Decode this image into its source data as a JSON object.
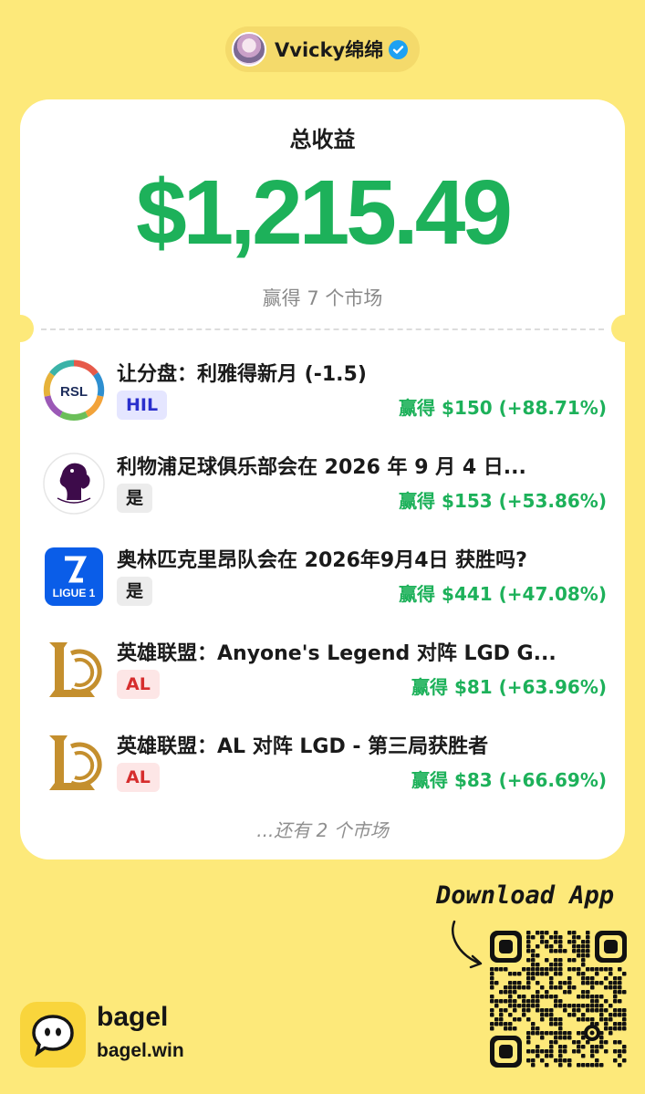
{
  "user": {
    "name": "Vvicky绵绵"
  },
  "summary": {
    "title": "总收益",
    "amount": "$1,215.49",
    "subtitle": "赢得 7 个市场"
  },
  "markets": [
    {
      "logo": "rsl-logo",
      "title": "让分盘：利雅得新月 (-1.5)",
      "badge": "HIL",
      "badge_style": "blue",
      "result": "赢得 $150 (+88.71%)"
    },
    {
      "logo": "premier-league-logo",
      "title": "利物浦足球俱乐部会在 2026 年 9 月 4 日...",
      "badge": "是",
      "badge_style": "gray",
      "result": "赢得 $153 (+53.86%)"
    },
    {
      "logo": "ligue1-logo",
      "title": "奥林匹克里昂队会在 2026年9月4日 获胜吗?",
      "badge": "是",
      "badge_style": "gray",
      "result": "赢得 $441 (+47.08%)"
    },
    {
      "logo": "lol-logo",
      "title": "英雄联盟：Anyone's Legend 对阵 LGD G...",
      "badge": "AL",
      "badge_style": "red",
      "result": "赢得 $81 (+63.96%)"
    },
    {
      "logo": "lol-logo",
      "title": "英雄联盟：AL 对阵 LGD - 第三局获胜者",
      "badge": "AL",
      "badge_style": "red",
      "result": "赢得 $83 (+66.69%)"
    }
  ],
  "more_markets": "...还有 2 个市场",
  "ligue1": {
    "text": "LIGUE 1"
  },
  "rsl": {
    "text": "RSL"
  },
  "brand": {
    "name": "bagel",
    "url": "bagel.win"
  },
  "download": {
    "label": "Download App"
  },
  "colors": {
    "background": "#FDE97A",
    "profit_green": "#1DB15A",
    "card": "#FFFFFF"
  }
}
